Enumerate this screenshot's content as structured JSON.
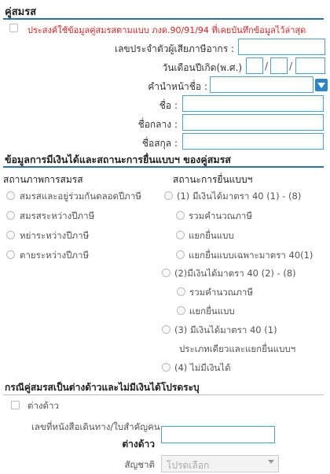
{
  "spouse_section": {
    "title": "คู่สมรส",
    "reuse_checkbox_label": "ประสงค์ใช้ข้อมูลคู่สมรสตามแบบ ภงด.90/91/94 ที่เคยบันทึกข้อมูลไว้ล่าสุด",
    "tax_id_label": "เลขประจำตัวผู้เสียภาษีอากร :",
    "birthdate_label": "วันเดือนปีเกิด(พ.ศ.)",
    "date_separator": "/",
    "prefix_label": "คำนำหน้าชื่อ :",
    "first_name_label": "ชื่อ :",
    "middle_name_label": "ชื่อกลาง :",
    "last_name_label": "ชื่อสกุล :",
    "values": {
      "tax_id": "",
      "birth_day": "",
      "birth_month": "",
      "birth_year": "",
      "prefix": "",
      "first_name": "",
      "middle_name": "",
      "last_name": ""
    }
  },
  "income_section": {
    "title": "ข้อมูลการมีเงินได้และสถานะการยื่นแบบฯ ของคู่สมรส",
    "marital_status_heading": "สถานภาพการสมรส",
    "filing_status_heading": "สถานะการยื่นแบบฯ",
    "marital_options": [
      "สมรสและอยู่ร่วมกันตลอดปีภาษี",
      "สมรสระหว่างปีภาษี",
      "หย่าระหว่างปีภาษี",
      "ตายระหว่างปีภาษี"
    ],
    "filing_options": {
      "opt1": "(1) มีเงินได้มาตรา 40 (1) - (8)",
      "opt1a": "รวมคำนวณภาษี",
      "opt1b": "แยกยื่นแบบ",
      "opt1c": "แยกยื่นแบบเฉพาะมาตรา 40(1)",
      "opt2": "(2)มีเงินได้มาตรา 40 (2) - (8)",
      "opt2a": "รวมคำนวณภาษี",
      "opt2b": "แยกยื่นแบบ",
      "opt3": "(3) มีเงินได้มาตรา 40 (1)",
      "opt3_note": "ประเภทเดียวและแยกยื่นแบบฯ",
      "opt4": "(4) ไม่มีเงินได้"
    }
  },
  "foreigner_section": {
    "title": "กรณีคู่สมรสเป็นต่างด้าวและไม่มีเงินได้โปรดระบุ",
    "foreigner_checkbox_label": "ต่างด้าว",
    "passport_label_line1": "เลขที่หนังสือเดินทาง/ใบสำคัญคน",
    "passport_label_line2": "ต่างด้าว",
    "nationality_label": "สัญชาติ",
    "nationality_placeholder": "โปรดเลือก",
    "passport_value": ""
  },
  "colors": {
    "accent_blue": "#2d6fb0",
    "input_border": "#4aa3d8",
    "warning_red": "#dd2222"
  }
}
